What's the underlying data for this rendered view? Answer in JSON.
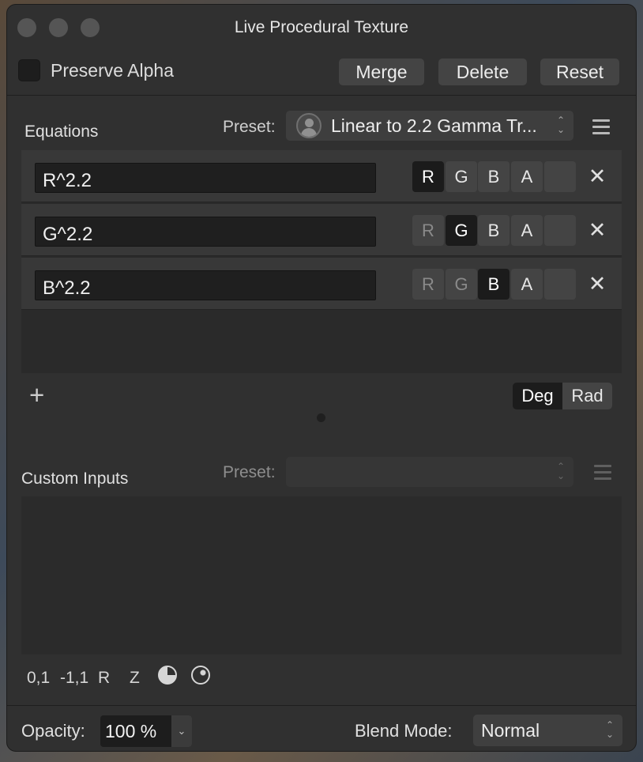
{
  "window": {
    "title": "Live Procedural Texture"
  },
  "toolbar": {
    "preserve_alpha_label": "Preserve Alpha",
    "merge_label": "Merge",
    "delete_label": "Delete",
    "reset_label": "Reset"
  },
  "equations": {
    "section_label": "Equations",
    "preset_label": "Preset:",
    "preset_value": "Linear to 2.2 Gamma Tr...",
    "rows": [
      {
        "formula": "R^2.2",
        "active_channel": "R"
      },
      {
        "formula": "G^2.2",
        "active_channel": "G"
      },
      {
        "formula": "B^2.2",
        "active_channel": "B"
      }
    ],
    "channels": [
      "R",
      "G",
      "B",
      "A"
    ],
    "remove_glyph": "✕",
    "add_glyph": "+",
    "angle_modes": {
      "deg": "Deg",
      "rad": "Rad",
      "selected": "Deg"
    }
  },
  "custom_inputs": {
    "section_label": "Custom Inputs",
    "preset_label": "Preset:",
    "tools": [
      "0,1",
      "-1,1",
      "R",
      "Z"
    ]
  },
  "footer": {
    "opacity_label": "Opacity:",
    "opacity_value": "100 %",
    "blend_label": "Blend Mode:",
    "blend_value": "Normal"
  },
  "icons": {
    "stepper": "up-down-stepper-icon",
    "dropdown": "chevron-down-icon",
    "menu": "hamburger-menu-icon"
  }
}
